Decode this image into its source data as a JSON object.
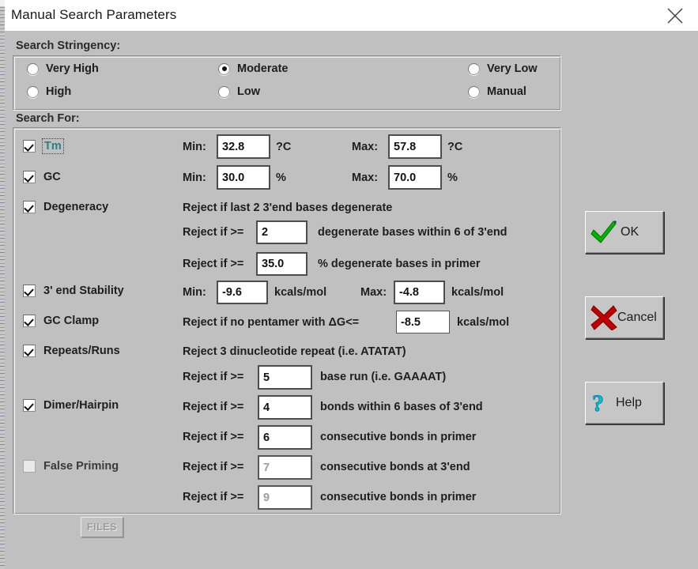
{
  "window": {
    "title": "Manual Search Parameters",
    "close_label": "✕"
  },
  "stringency": {
    "legend": "Search Stringency:",
    "options": [
      {
        "label": "Very High",
        "checked": false
      },
      {
        "label": "High",
        "checked": false
      },
      {
        "label": "Moderate",
        "checked": true
      },
      {
        "label": "Low",
        "checked": false
      },
      {
        "label": "Very Low",
        "checked": false
      },
      {
        "label": "Manual",
        "checked": false
      }
    ]
  },
  "search_for": {
    "legend": "Search For:",
    "tm": {
      "checkbox_label": "Tm",
      "checked": true,
      "min_label": "Min:",
      "min_value": "32.8",
      "min_unit": "?C",
      "max_label": "Max:",
      "max_value": "57.8",
      "max_unit": "?C"
    },
    "gc": {
      "checkbox_label": "GC",
      "checked": true,
      "min_label": "Min:",
      "min_value": "30.0",
      "min_unit": "%",
      "max_label": "Max:",
      "max_value": "70.0",
      "max_unit": "%"
    },
    "degeneracy": {
      "checkbox_label": "Degeneracy",
      "checked": true,
      "note": "Reject if last 2 3'end bases degenerate",
      "reject1_prefix": "Reject if >=",
      "reject1_value": "2",
      "reject1_suffix": "degenerate bases within 6 of 3'end",
      "reject2_prefix": "Reject if >=",
      "reject2_value": "35.0",
      "reject2_suffix": "% degenerate bases in primer"
    },
    "stability": {
      "checkbox_label": "3' end Stability",
      "checked": true,
      "min_label": "Min:",
      "min_value": "-9.6",
      "min_unit": "kcals/mol",
      "max_label": "Max:",
      "max_value": "-4.8",
      "max_unit": "kcals/mol"
    },
    "gc_clamp": {
      "checkbox_label": "GC Clamp",
      "checked": true,
      "prefix": "Reject if no pentamer with ΔG<=",
      "value": "-8.5",
      "suffix": "kcals/mol"
    },
    "repeats": {
      "checkbox_label": "Repeats/Runs",
      "checked": true,
      "note": "Reject 3 dinucleotide repeat (i.e. ATATAT)",
      "reject_prefix": "Reject if >=",
      "reject_value": "5",
      "reject_suffix": "base run (i.e. GAAAAT)"
    },
    "dimer": {
      "checkbox_label": "Dimer/Hairpin",
      "checked": true,
      "reject1_prefix": "Reject if >=",
      "reject1_value": "4",
      "reject1_suffix": "bonds within 6 bases of 3'end",
      "reject2_prefix": "Reject if >=",
      "reject2_value": "6",
      "reject2_suffix": "consecutive bonds in primer"
    },
    "false_priming": {
      "checkbox_label": "False Priming",
      "checked": false,
      "files_button": "FILES",
      "reject1_prefix": "Reject if >=",
      "reject1_value": "7",
      "reject1_suffix": "consecutive bonds at 3'end",
      "reject2_prefix": "Reject if >=",
      "reject2_value": "9",
      "reject2_suffix": "consecutive bonds in primer"
    }
  },
  "buttons": {
    "ok": "OK",
    "cancel": "Cancel",
    "help": "Help"
  },
  "colors": {
    "dialog_face": "#c0c0c0",
    "ok_check": "#00b400",
    "cancel_x": "#c00000",
    "help_question": "#00c8d2",
    "focus_text": "#2b7f86"
  }
}
